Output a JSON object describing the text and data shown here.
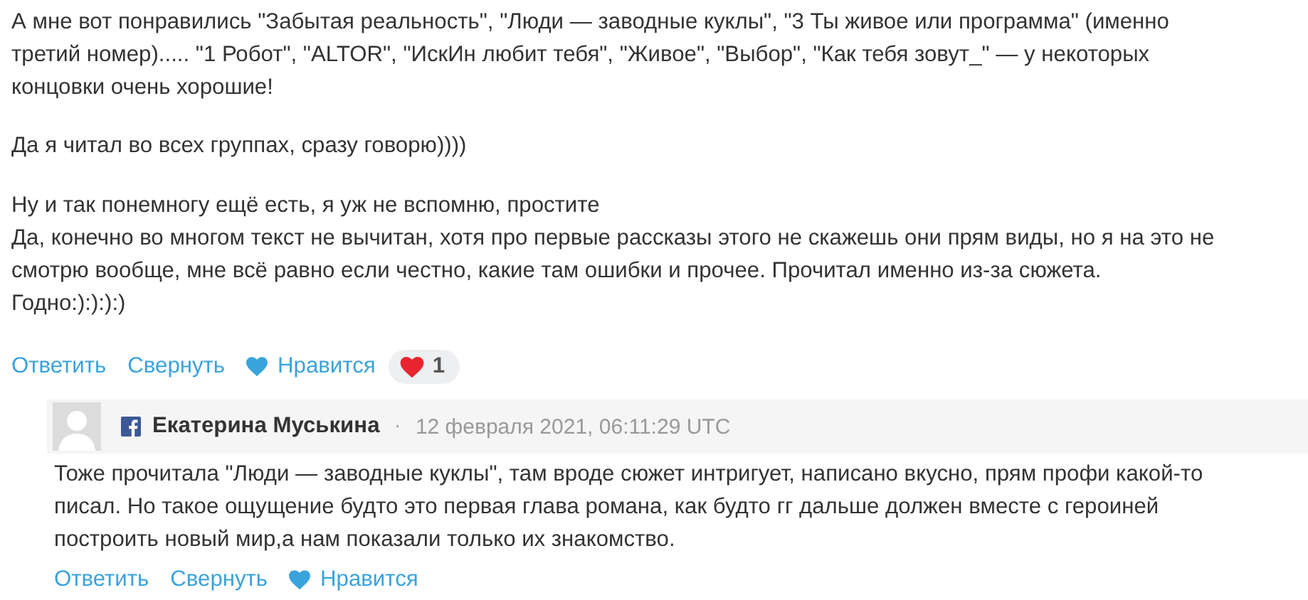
{
  "comment": {
    "blocks": [
      [
        "А мне вот понравились \"Забытая реальность\", \"Люди — заводные куклы\", \"3 Ты живое или программа\" (именно третий номер)..... \"1 Робот\", \"ALTOR\", \"ИскИн любит тебя\", \"Живое\", \"Выбор\", \"Как тебя зовут_\" — у некоторых концовки очень хорошие!"
      ],
      [
        "Да я читал во всех группах, сразу говорю))))"
      ],
      [
        "Ну и так понемногу ещё есть, я уж не вспомню, простите",
        "Да, конечно во многом текст не вычитан, хотя про первые рассказы этого не скажешь они прям виды, но я на это не смотрю вообще, мне всё равно если честно, какие там ошибки и прочее. Прочитал именно из-за сюжета. Годно:):):):)"
      ]
    ],
    "actions": {
      "reply": "Ответить",
      "collapse": "Свернуть",
      "like": "Нравится"
    },
    "likes": {
      "count": "1"
    }
  },
  "reply": {
    "author": "Екатерина Муськина",
    "separator": "·",
    "date": "12 февраля 2021, 06:11:29 UTC",
    "text": "Тоже прочитала \"Люди — заводные куклы\", там вроде сюжет интригует, написано вкусно, прям профи какой-то писал. Но такое ощущение будто это первая глава романа, как будто гг дальше должен вместе с героиней построить новый мир,а нам показали только их знакомство.",
    "actions": {
      "reply": "Ответить",
      "collapse": "Свернуть",
      "like": "Нравится"
    }
  }
}
